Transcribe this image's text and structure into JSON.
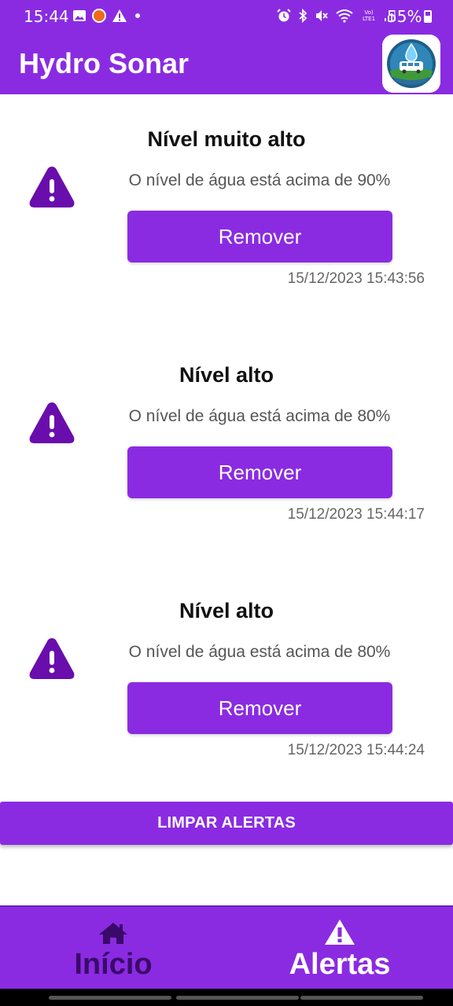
{
  "status_bar": {
    "time": "15:44",
    "battery": "55%",
    "left_icons": [
      "gallery-icon",
      "app-notification-icon",
      "warning-icon",
      "dot-icon"
    ],
    "right_icons": [
      "alarm-icon",
      "bluetooth-icon",
      "mute-icon",
      "wifi-icon",
      "volte-icon",
      "signal-icon",
      "battery-icon"
    ]
  },
  "app_bar": {
    "title": "Hydro Sonar"
  },
  "alerts": [
    {
      "title": "Nível muito alto",
      "message": "O nível de água está acima de 90%",
      "button_label": "Remover",
      "timestamp": "15/12/2023 15:43:56"
    },
    {
      "title": "Nível alto",
      "message": "O nível de água está acima de 80%",
      "button_label": "Remover",
      "timestamp": "15/12/2023 15:44:17"
    },
    {
      "title": "Nível alto",
      "message": "O nível de água está acima de 80%",
      "button_label": "Remover",
      "timestamp": "15/12/2023 15:44:24"
    }
  ],
  "clear_button": {
    "label": "LIMPAR ALERTAS"
  },
  "bottom_nav": {
    "home_label": "Início",
    "alerts_label": "Alertas",
    "selected": "alerts"
  },
  "colors": {
    "primary": "#8a2be2",
    "icon": "#6a0dad",
    "nav_inactive": "#3a0a6a"
  }
}
